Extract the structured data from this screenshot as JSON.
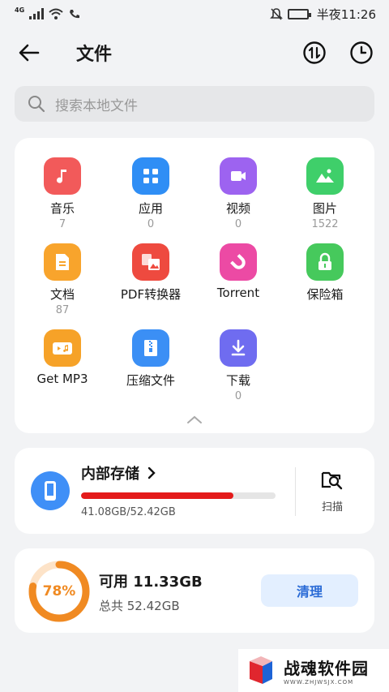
{
  "status_bar": {
    "network": "4G",
    "time": "半夜11:26"
  },
  "header": {
    "title": "文件"
  },
  "search": {
    "placeholder": "搜索本地文件"
  },
  "categories": [
    {
      "label": "音乐",
      "count": "7",
      "icon": "music-icon",
      "color": "#f25a5a"
    },
    {
      "label": "应用",
      "count": "0",
      "icon": "apps-icon",
      "color": "#2f8ef5"
    },
    {
      "label": "视频",
      "count": "0",
      "icon": "video-icon",
      "color": "#9d63f0"
    },
    {
      "label": "图片",
      "count": "1522",
      "icon": "image-icon",
      "color": "#3fcf6a"
    },
    {
      "label": "文档",
      "count": "87",
      "icon": "document-icon",
      "color": "#f8a42c"
    },
    {
      "label": "PDF转换器",
      "count": "",
      "icon": "pdf-convert-icon",
      "color": "#ee4a3f"
    },
    {
      "label": "Torrent",
      "count": "",
      "icon": "magnet-icon",
      "color": "#ec4aa4"
    },
    {
      "label": "保险箱",
      "count": "",
      "icon": "lock-icon",
      "color": "#46c95c"
    },
    {
      "label": "Get MP3",
      "count": "",
      "icon": "mp3-icon",
      "color": "#f6a228"
    },
    {
      "label": "压缩文件",
      "count": "",
      "icon": "zip-icon",
      "color": "#3b8ff5"
    },
    {
      "label": "下载",
      "count": "0",
      "icon": "download-icon",
      "color": "#6f6cf0"
    }
  ],
  "storage": {
    "title": "内部存储",
    "used_fraction": 0.784,
    "size_text": "41.08GB/52.42GB",
    "scan_label": "扫描",
    "bar_color": "#e41b1b"
  },
  "available": {
    "percent": "78%",
    "percent_value": 0.78,
    "title": "可用 11.33GB",
    "total": "总共 52.42GB",
    "clean_label": "清理"
  },
  "watermark": {
    "name": "战魂软件园",
    "url": "WWW.ZHJWSJX.COM"
  }
}
